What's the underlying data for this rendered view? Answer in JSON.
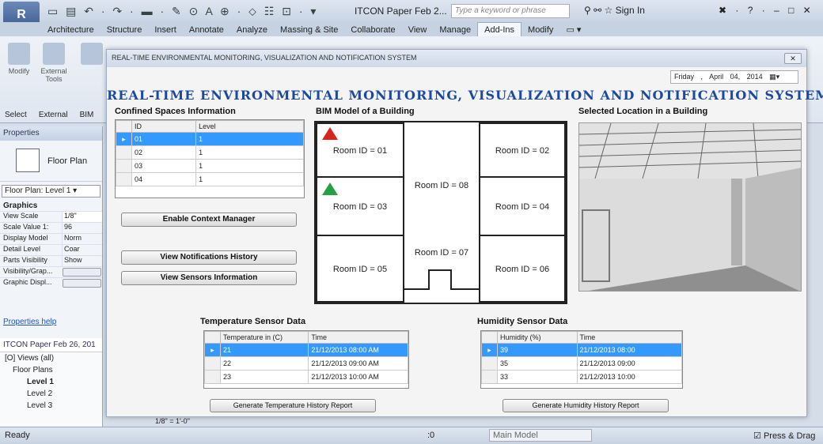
{
  "titlebar": {
    "app_glyph": "R",
    "qat_icons": "▭ ▤ ↶ · ↷ · ▬ · ✎ ⊙ A ⊕ · ⬦ ☷ ⊡ · ▾",
    "doc_title": "ITCON Paper Feb 2...",
    "search_placeholder": "Type a keyword or phrase",
    "signin": "Sign In",
    "signin_icons": "⚲ ⚯ ☆",
    "window_controls": "✖ · ? ·  – □ ✕"
  },
  "ribbon": {
    "tabs": [
      "Architecture",
      "Structure",
      "Insert",
      "Annotate",
      "Analyze",
      "Massing & Site",
      "Collaborate",
      "View",
      "Manage",
      "Add-Ins",
      "Modify",
      "▭ ▾"
    ],
    "active_tab": "Add-Ins",
    "buttons": [
      "Modify",
      "External Tools"
    ],
    "panels": [
      "Select",
      "External",
      "BIM"
    ]
  },
  "properties": {
    "header": "Properties",
    "type_name": "Floor Plan",
    "type_selector": "Floor Plan: Level 1",
    "group": "Graphics",
    "rows": [
      {
        "label": "View Scale",
        "value": "1/8\""
      },
      {
        "label": "Scale Value  1:",
        "value": "96"
      },
      {
        "label": "Display Model",
        "value": "Norm"
      },
      {
        "label": "Detail Level",
        "value": "Coar"
      },
      {
        "label": "Parts Visibility",
        "value": "Show"
      },
      {
        "label": "Visibility/Grap...",
        "value": ""
      },
      {
        "label": "Graphic Displ...",
        "value": ""
      }
    ],
    "help_link": "Properties help"
  },
  "project_browser": {
    "header": "ITCON Paper Feb 26, 201",
    "items": [
      "[O] Views (all)",
      "Floor Plans",
      "Level 1",
      "Level 2",
      "Level 3"
    ],
    "scale_bar": "1/8\" = 1'-0\""
  },
  "dialog": {
    "window_title": "REAL-TIME ENVIRONMENTAL MONITORING, VISUALIZATION AND NOTIFICATION SYSTEM",
    "close_label": "✕",
    "date": {
      "day": "Friday",
      "sep": ",",
      "month": "April",
      "daynum": "04, 2014"
    },
    "main_title": "REAL-TIME ENVIRONMENTAL MONITORING, VISUALIZATION AND NOTIFICATION SYSTEM",
    "confined": {
      "title": "Confined Spaces Information",
      "columns": [
        "ID",
        "Level"
      ],
      "rows": [
        [
          "01",
          "1"
        ],
        [
          "02",
          "1"
        ],
        [
          "03",
          "1"
        ],
        [
          "04",
          "1"
        ]
      ]
    },
    "buttons": {
      "context": "Enable Context Manager",
      "notifications": "View Notifications History",
      "sensors": "View Sensors Information",
      "temp_report": "Generate Temperature History Report",
      "hum_report": "Generate Humidity History Report"
    },
    "bim": {
      "title": "BIM Model of a Building",
      "rooms": [
        "Room ID = 01",
        "Room ID = 02",
        "Room ID = 03",
        "Room ID = 04",
        "Room ID = 05",
        "Room ID = 06",
        "Room ID = 07",
        "Room ID = 08"
      ],
      "alarm_color": "#d8231f",
      "ok_color": "#27a045"
    },
    "location": {
      "title": "Selected Location in a Building"
    },
    "temperature": {
      "title": "Temperature Sensor Data",
      "columns": [
        "Temperature in (C)",
        "Time"
      ],
      "rows": [
        [
          "21",
          "21/12/2013  08:00 AM"
        ],
        [
          "22",
          "21/12/2013  09:00 AM"
        ],
        [
          "23",
          "21/12/2013  10:00 AM"
        ]
      ]
    },
    "humidity": {
      "title": "Humidity Sensor Data",
      "columns": [
        "Humidity (%)",
        "Time"
      ],
      "rows": [
        [
          "39",
          "21/12/2013  08:00"
        ],
        [
          "35",
          "21/12/2013  09:00"
        ],
        [
          "33",
          "21/12/2013  10:00"
        ]
      ]
    }
  },
  "statusbar": {
    "ready": "Ready",
    "coord": ":0",
    "model": "Main Model",
    "press_drag": "Press & Drag"
  },
  "accent_color": "#1c4aa0",
  "selection_color": "#3399ff"
}
